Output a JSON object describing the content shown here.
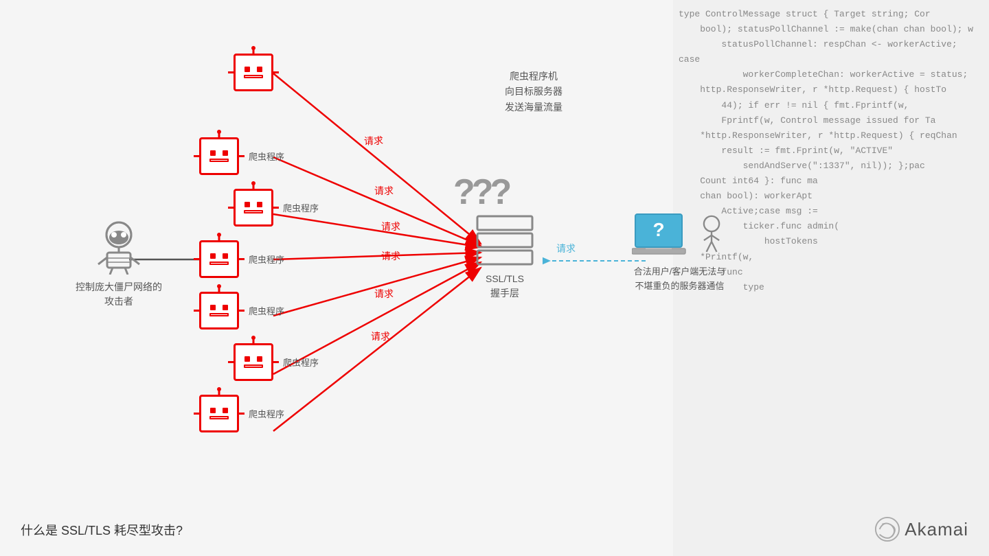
{
  "title": "什么是 SSL/TLS 耗尽型攻击?",
  "diagram": {
    "attacker_label": "控制庞大僵尸网络的\n攻击者",
    "server_label": "SSL/TLS\n握手层",
    "question_marks": "???",
    "top_label": "爬虫程序机\n向目标服务器\n发送海量流量",
    "user_label": "合法用户/客户端无法与\n不堪重负的服务器通信",
    "request_label": "请求",
    "dashed_request_label": "请求",
    "bot_label": "爬虫程序",
    "bots": [
      {
        "id": 1,
        "label": "爬虫程序"
      },
      {
        "id": 2,
        "label": "爬虫程序"
      },
      {
        "id": 3,
        "label": "爬虫程序"
      },
      {
        "id": 4,
        "label": "爬虫程序"
      },
      {
        "id": 5,
        "label": "爬虫程序"
      },
      {
        "id": 6,
        "label": "爬虫程序"
      },
      {
        "id": 7,
        "label": "爬虫程序"
      }
    ]
  },
  "code_lines": [
    "type ControlMessage struct { Target string; Cor",
    "    bool); statusPollChannel := make(chan chan bool); w",
    "        statusPollChannel: respChan <- workerActive; case",
    "            workerCompleteChan: workerActive = status;",
    "    http.ResponseWriter, r *http.Request) { hostTo",
    "        44); if err != nil { fmt.Fprintf(w,",
    "        Fprintf(w, Control message issued for Ta",
    "    *http.ResponseWriter, r *http.Request) { reqChan",
    "        result := fmt.Fprint(w, \"ACTIVE\"",
    "            sendAndServe(\":1337\", nil)); };pac",
    "    Count int64 }: func ma",
    "    chan bool): workerApt",
    "        Active;case msg :=",
    "            ticker.func admin(",
    "                hostTokens",
    "    *Printf(w,",
    "        func",
    "            type"
  ],
  "akamai_label": "Akamai"
}
